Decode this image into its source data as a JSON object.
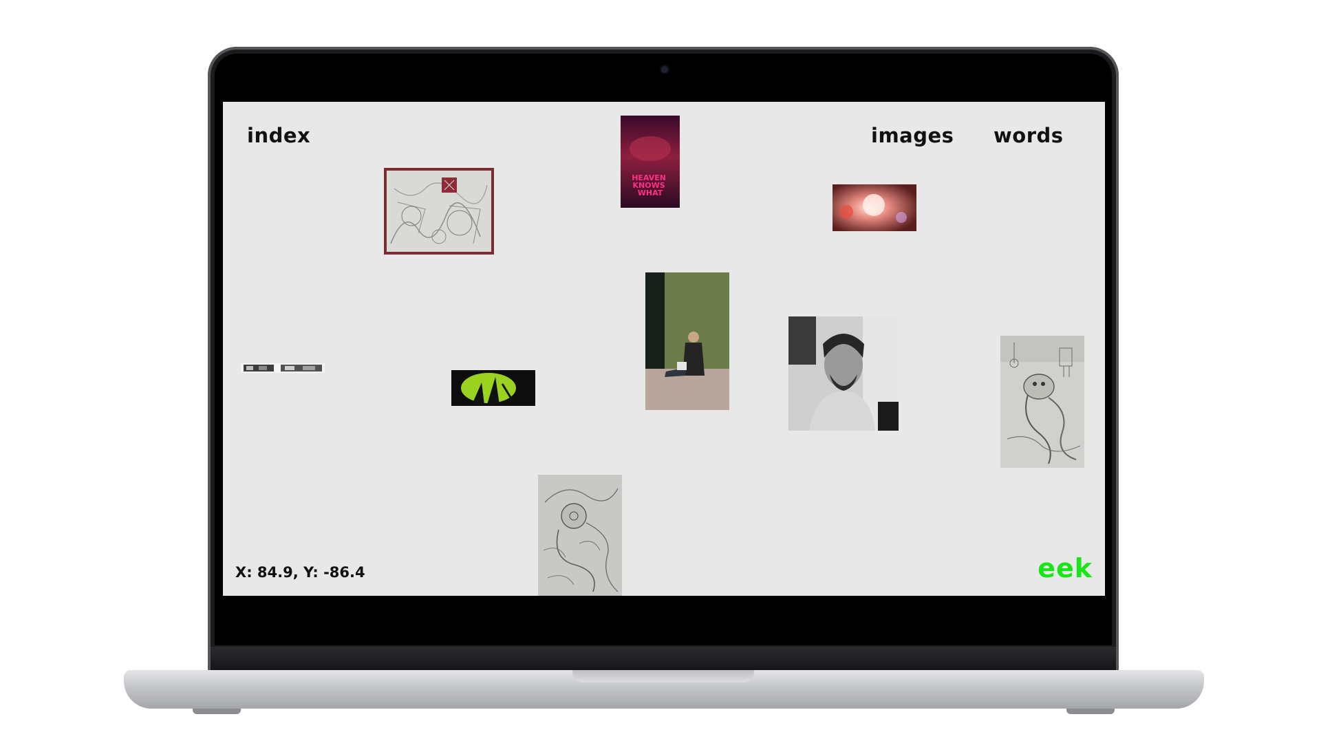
{
  "nav": {
    "index_label": "index",
    "images_label": "images",
    "words_label": "words"
  },
  "status": {
    "coordinates": "X: 84.9, Y: -86.4"
  },
  "brand": {
    "label": "eek",
    "color": "#19e619"
  },
  "poster": {
    "title": "HEAVEN KNOWS WHAT"
  },
  "colors": {
    "screen_background": "#e8e8e8",
    "text": "#111111"
  }
}
